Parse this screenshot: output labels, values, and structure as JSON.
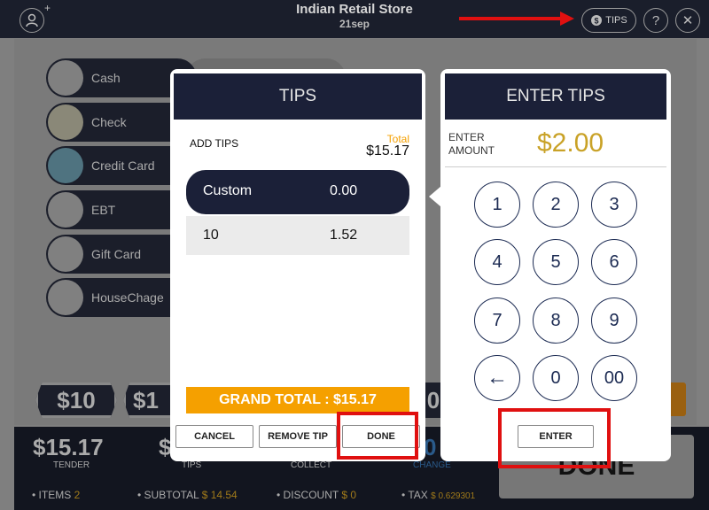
{
  "header": {
    "store_name": "Indian Retail Store",
    "subtitle": "21sep",
    "tips_label": "TIPS"
  },
  "payment_methods": [
    "Cash",
    "Check",
    "Credit Card",
    "EBT",
    "Gift Card",
    "HouseChage"
  ],
  "quick_amounts": [
    "$10",
    "$1",
    "0"
  ],
  "summary": {
    "tender_value": "$15.17",
    "tender_label": "TENDER",
    "tips_value": "$",
    "tips_label": "TIPS",
    "collect_label": "COLLECT",
    "change_value": "0",
    "change_label": "CHANGE",
    "items_label": "ITEMS",
    "items_value": "2",
    "subtotal_label": "SUBTOTAL",
    "subtotal_value": "$ 14.54",
    "discount_label": "DISCOUNT",
    "discount_value": "$ 0",
    "tax_label": "TAX",
    "tax_value": "$ 0.629301",
    "done_label": "DONE"
  },
  "tips_dialog": {
    "title": "TIPS",
    "add_tips_label": "ADD TIPS",
    "total_label": "Total",
    "total_value": "$15.17",
    "options": [
      {
        "name": "Custom",
        "amount": "0.00",
        "selected": true
      },
      {
        "name": "10",
        "amount": "1.52",
        "selected": false
      }
    ],
    "grand_total": "GRAND TOTAL :  $15.17",
    "cancel_label": "CANCEL",
    "remove_tip_label": "REMOVE TIP",
    "done_label": "DONE"
  },
  "enter_tips_dialog": {
    "title": "ENTER TIPS",
    "enter_amount_label_1": "ENTER",
    "enter_amount_label_2": "AMOUNT",
    "amount": "$2.00",
    "keys": [
      "1",
      "2",
      "3",
      "4",
      "5",
      "6",
      "7",
      "8",
      "9",
      "←",
      "0",
      "00"
    ],
    "enter_label": "ENTER"
  },
  "colors": {
    "accent": "#c9a227",
    "orange": "#f5a000",
    "navy": "#1b2038",
    "highlight": "#e01010"
  }
}
